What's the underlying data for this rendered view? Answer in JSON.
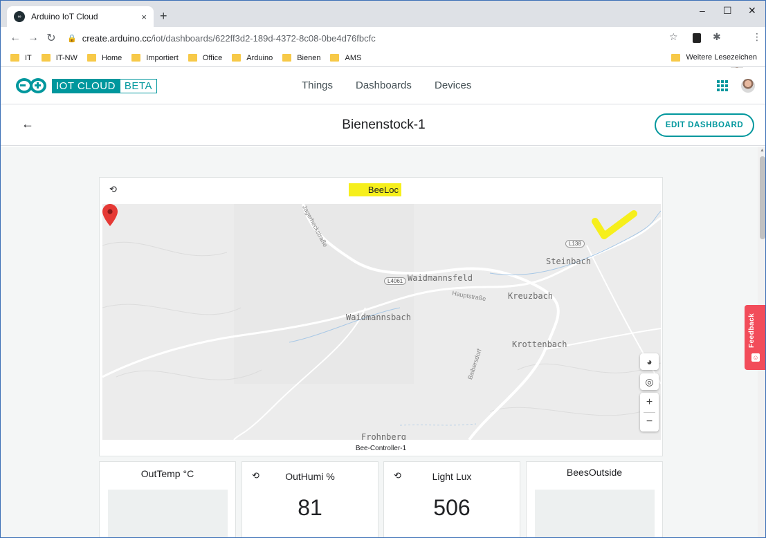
{
  "browser": {
    "tab_title": "Arduino IoT Cloud",
    "tab_close": "×",
    "new_tab": "+",
    "window_controls": [
      "–",
      "☐",
      "✕"
    ],
    "url_host": "create.arduino.cc",
    "url_path": "/iot/dashboards/622ff3d2-189d-4372-8c08-0be4d76fbcfc",
    "bookmarks": [
      "IT",
      "IT-NW",
      "Home",
      "Importiert",
      "Office",
      "Arduino",
      "Bienen",
      "AMS"
    ],
    "other_bookmarks": "Weitere Lesezeichen"
  },
  "app": {
    "brand": "IOT CLOUD",
    "badge": "BETA",
    "nav": [
      "Things",
      "Dashboards",
      "Devices"
    ]
  },
  "dashboard": {
    "title": "Bienenstock-1",
    "edit_button": "EDIT DASHBOARD"
  },
  "map_widget": {
    "title": "BeeLoc",
    "device": "Bee-Controller-1",
    "highlight_color": "#f6ef1c",
    "places": [
      "Waidmannsfeld",
      "Steinbach",
      "Kreuzbach",
      "Waidmannsbach",
      "Krottenbach",
      "Frohnberg"
    ],
    "road_tags": [
      "L4061",
      "L138"
    ],
    "streets": [
      "Hauptstraße",
      "Baibersdorf",
      "Jagerheckstraße"
    ],
    "controls": {
      "zoom_in": "+",
      "zoom_out": "−"
    }
  },
  "cards": [
    {
      "title": "OutTemp °C",
      "value": ""
    },
    {
      "title": "OutHumi %",
      "value": "81"
    },
    {
      "title": "Light Lux",
      "value": "506"
    },
    {
      "title": "BeesOutside",
      "value": ""
    }
  ],
  "feedback": {
    "label": "Feedback"
  },
  "colors": {
    "accent": "#00979d",
    "feedback": "#f24c5a",
    "pin": "#e53935"
  }
}
